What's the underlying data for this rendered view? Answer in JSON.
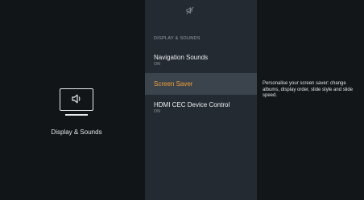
{
  "category": {
    "label": "Display & Sounds",
    "icon": "speaker-tv-icon"
  },
  "menu": {
    "top_icon": "mute-icon",
    "section_header": "DISPLAY & SOUNDS",
    "items": [
      {
        "title": "Navigation Sounds",
        "value": "ON",
        "selected": false
      },
      {
        "title": "Screen Saver",
        "value": "",
        "selected": true
      },
      {
        "title": "HDMI CEC Device Control",
        "value": "ON",
        "selected": false
      }
    ]
  },
  "description": "Personalise your screen saver: change albums, display order, slide style and slide speed.",
  "colors": {
    "background": "#131619",
    "menu_panel": "#232a31",
    "selected_row": "#3b444c",
    "selected_text": "#f29d34"
  }
}
